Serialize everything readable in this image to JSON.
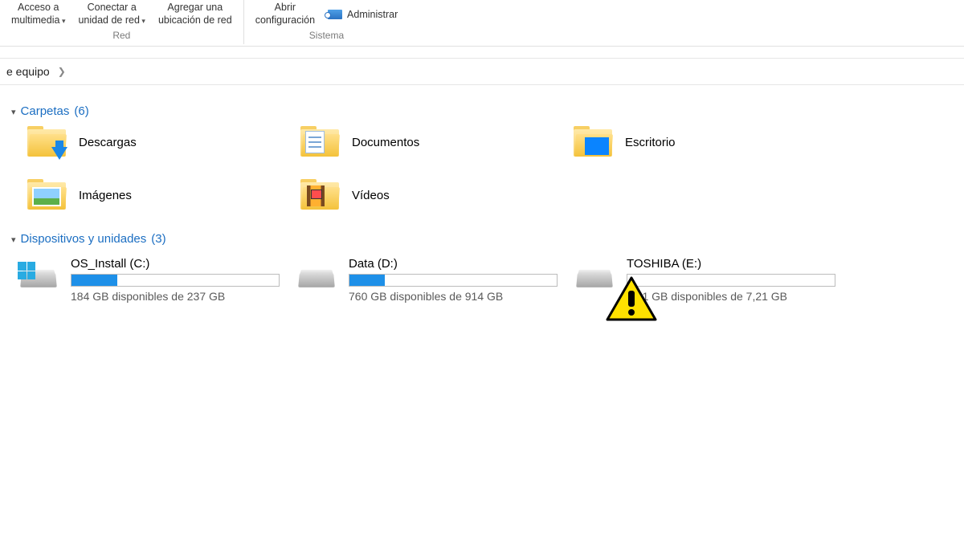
{
  "ribbon": {
    "network": {
      "label": "Red",
      "buttons": [
        {
          "l1": "Acceso a",
          "l2": "multimedia",
          "dropdown": true
        },
        {
          "l1": "Conectar a",
          "l2": "unidad de red",
          "dropdown": true
        },
        {
          "l1": "Agregar una",
          "l2": "ubicación de red",
          "dropdown": false
        }
      ]
    },
    "system": {
      "label": "Sistema",
      "open_config": {
        "l1": "Abrir",
        "l2": "configuración"
      },
      "admin": "Administrar"
    }
  },
  "breadcrumb": {
    "segment": "e equipo"
  },
  "sections": {
    "folders": {
      "title": "Carpetas",
      "count": "(6)",
      "items": [
        {
          "name": "Descargas",
          "icon": "downloads"
        },
        {
          "name": "Documentos",
          "icon": "documents"
        },
        {
          "name": "Escritorio",
          "icon": "desktop"
        },
        {
          "name": "Imágenes",
          "icon": "images"
        },
        {
          "name": "Vídeos",
          "icon": "videos"
        }
      ]
    },
    "drives": {
      "title": "Dispositivos y unidades",
      "count": "(3)",
      "items": [
        {
          "name": "OS_Install (C:)",
          "free_text": "184 GB disponibles de 237 GB",
          "fill_percent": 22,
          "windows_logo": true,
          "warning": false
        },
        {
          "name": "Data (D:)",
          "free_text": "760 GB disponibles de 914 GB",
          "fill_percent": 17,
          "windows_logo": false,
          "warning": false
        },
        {
          "name": "TOSHIBA (E:)",
          "free_text": "7,21 GB disponibles de 7,21 GB",
          "fill_percent": 0,
          "windows_logo": false,
          "warning": true
        }
      ]
    }
  }
}
